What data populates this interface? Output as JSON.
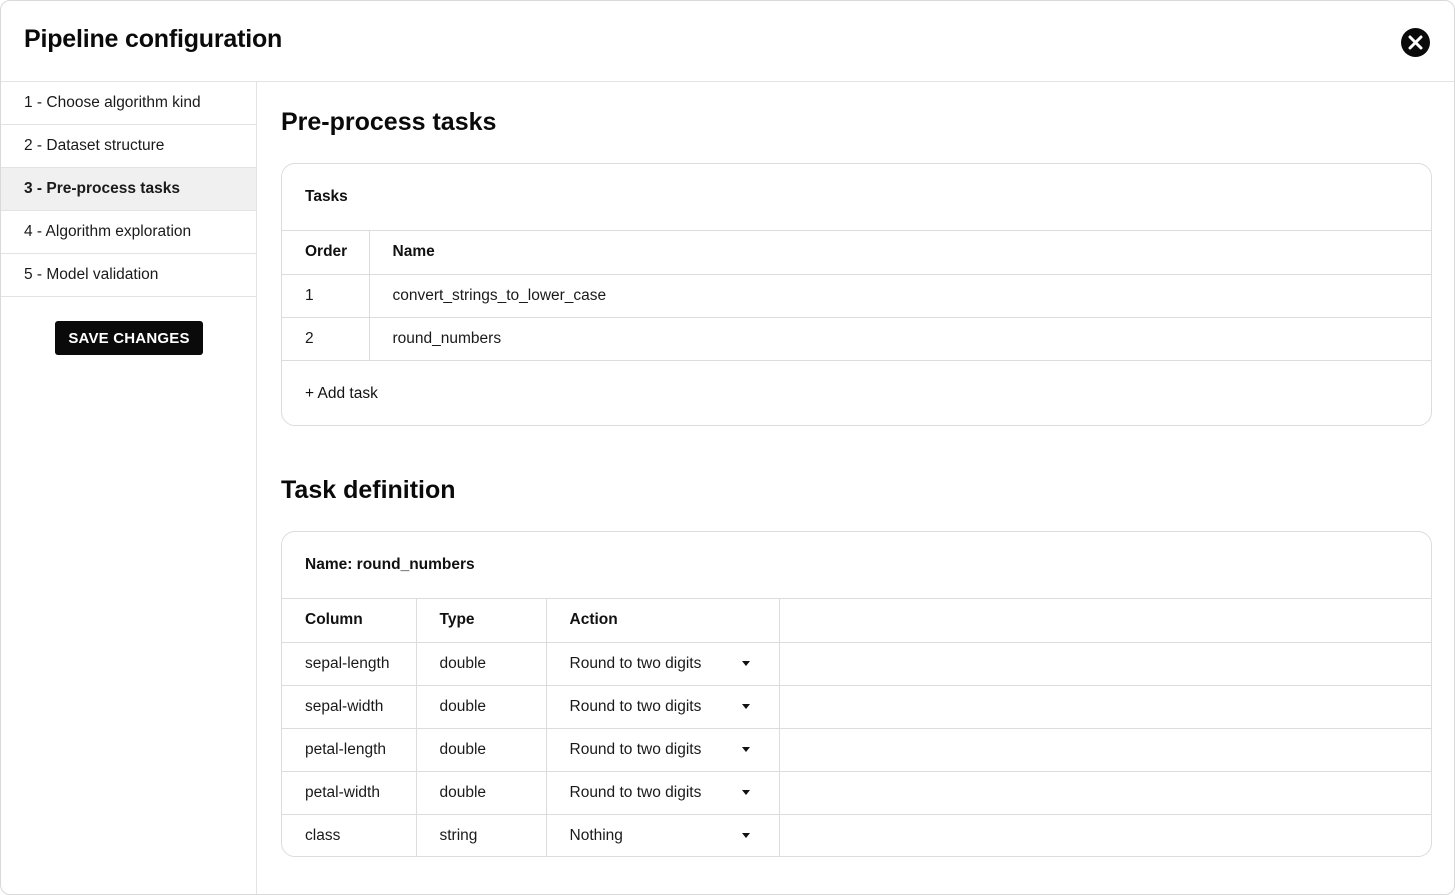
{
  "header": {
    "title": "Pipeline configuration",
    "close_icon": "close-icon"
  },
  "sidebar": {
    "items": [
      {
        "label": "1 - Choose algorithm kind"
      },
      {
        "label": "2 - Dataset structure"
      },
      {
        "label": "3 - Pre-process tasks",
        "active": true
      },
      {
        "label": "4 - Algorithm exploration"
      },
      {
        "label": "5 - Model validation"
      }
    ],
    "save_label": "SAVE CHANGES"
  },
  "preprocess": {
    "title": "Pre-process tasks",
    "card_title": "Tasks",
    "columns": {
      "order": "Order",
      "name": "Name"
    },
    "rows": [
      {
        "order": "1",
        "name": "convert_strings_to_lower_case"
      },
      {
        "order": "2",
        "name": "round_numbers"
      }
    ],
    "add_label": "+ Add task"
  },
  "definition": {
    "title": "Task definition",
    "card_title": "Name: round_numbers",
    "columns": {
      "column": "Column",
      "type": "Type",
      "action": "Action"
    },
    "rows": [
      {
        "column": "sepal-length",
        "type": "double",
        "action": "Round to two digits"
      },
      {
        "column": "sepal-width",
        "type": "double",
        "action": "Round to two digits"
      },
      {
        "column": "petal-length",
        "type": "double",
        "action": "Round to two digits"
      },
      {
        "column": "petal-width",
        "type": "double",
        "action": "Round to two digits"
      },
      {
        "column": "class",
        "type": "string",
        "action": "Nothing"
      }
    ]
  },
  "colors": {
    "accent": "#0a0a0a",
    "active_bg": "#f0f0f0",
    "border": "#dcdcdc"
  }
}
